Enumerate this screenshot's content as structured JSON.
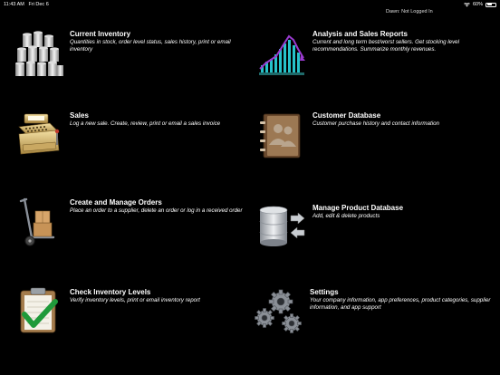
{
  "status_bar": {
    "time": "11:43 AM",
    "date": "Fri Dec 6",
    "battery_text": "60%",
    "battery_level": 0.6
  },
  "login_status": "Dawn: Not Logged In",
  "tiles": [
    {
      "title": "Current Inventory",
      "desc": "Quantities in stock, order level status, sales history, print or email inventory",
      "icon": "inventory-stack-icon"
    },
    {
      "title": "Analysis and Sales Reports",
      "desc": "Current and long term best/worst sellers.  Get stocking level recommendations. Summarize monthly revenues.",
      "icon": "sales-chart-icon"
    },
    {
      "title": "Sales",
      "desc": "Log a new sale. Create, review, print or email a sales invoice",
      "icon": "cash-register-icon"
    },
    {
      "title": "Customer Database",
      "desc": "Customer purchase history and contact information",
      "icon": "address-book-icon"
    },
    {
      "title": "Create and Manage Orders",
      "desc": "Place an order to a supplier, delete an order or log in a received order",
      "icon": "hand-truck-icon"
    },
    {
      "title": "Manage Product Database",
      "desc": "Add, edit & delete products",
      "icon": "database-icon"
    },
    {
      "title": "Check Inventory Levels",
      "desc": "Verify inventory levels, print or email inventory report",
      "icon": "clipboard-check-icon"
    },
    {
      "title": "Settings",
      "desc": "Your company information, app preferences, product categories, supplier information, and app support",
      "icon": "gears-icon"
    }
  ]
}
